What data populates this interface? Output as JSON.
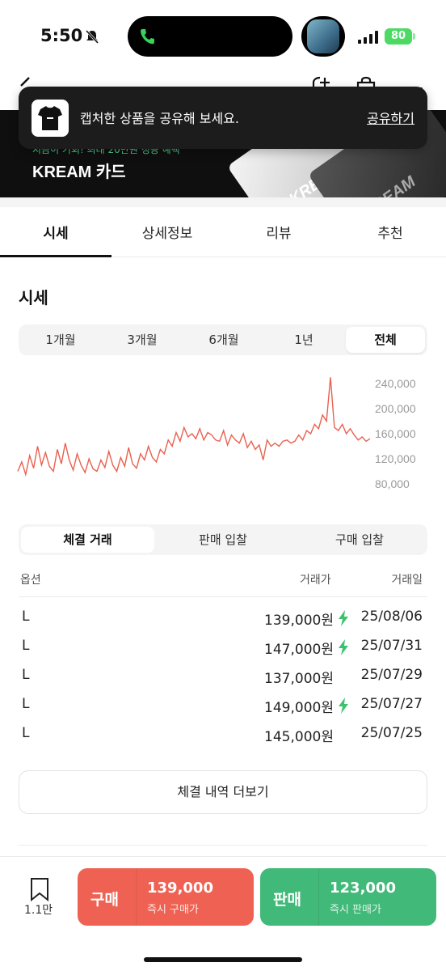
{
  "status": {
    "time": "5:50",
    "battery": "80"
  },
  "banner": {
    "small_text": "지금이 기회! 최대 20만원 정용 혜택",
    "title": "KREAM 카드",
    "card_text_1": "KREAM",
    "card_text_2": "KREAM"
  },
  "toast": {
    "message": "캡처한 상품을 공유해 보세요.",
    "action": "공유하기"
  },
  "tabs": [
    {
      "label": "시세"
    },
    {
      "label": "상세정보"
    },
    {
      "label": "리뷰"
    },
    {
      "label": "추천"
    }
  ],
  "price_section": {
    "title": "시세",
    "periods": [
      {
        "label": "1개월"
      },
      {
        "label": "3개월"
      },
      {
        "label": "6개월"
      },
      {
        "label": "1년"
      },
      {
        "label": "전체"
      }
    ],
    "active_period": "전체"
  },
  "chart_data": {
    "type": "line",
    "yticks": [
      "240,000",
      "200,000",
      "160,000",
      "120,000",
      "80,000"
    ],
    "ylim": [
      80000,
      240000
    ],
    "color": "#e9604f",
    "values": [
      100000,
      115000,
      95000,
      125000,
      105000,
      140000,
      110000,
      130000,
      108000,
      100000,
      135000,
      112000,
      145000,
      118000,
      102000,
      128000,
      110000,
      98000,
      120000,
      104000,
      100000,
      118000,
      106000,
      132000,
      110000,
      100000,
      122000,
      108000,
      138000,
      112000,
      105000,
      128000,
      118000,
      140000,
      122000,
      115000,
      135000,
      128000,
      150000,
      140000,
      162000,
      148000,
      170000,
      155000,
      160000,
      152000,
      168000,
      150000,
      162000,
      158000,
      150000,
      148000,
      165000,
      142000,
      158000,
      150000,
      145000,
      160000,
      138000,
      148000,
      135000,
      142000,
      118000,
      150000,
      140000,
      145000,
      140000,
      148000,
      150000,
      145000,
      148000,
      158000,
      150000,
      165000,
      160000,
      175000,
      168000,
      190000,
      180000,
      250000,
      170000,
      165000,
      175000,
      160000,
      168000,
      158000,
      150000,
      155000,
      148000,
      152000
    ]
  },
  "deal_tabs": [
    {
      "label": "체결 거래"
    },
    {
      "label": "판매 입찰"
    },
    {
      "label": "구매 입찰"
    }
  ],
  "table": {
    "headers": {
      "option": "옵션",
      "price": "거래가",
      "date": "거래일"
    },
    "rows": [
      {
        "option": "L",
        "price": "139,000원",
        "date": "25/08/06",
        "quick": true
      },
      {
        "option": "L",
        "price": "147,000원",
        "date": "25/07/31",
        "quick": true
      },
      {
        "option": "L",
        "price": "137,000원",
        "date": "25/07/29",
        "quick": false
      },
      {
        "option": "L",
        "price": "149,000원",
        "date": "25/07/27",
        "quick": true
      },
      {
        "option": "L",
        "price": "145,000원",
        "date": "25/07/25",
        "quick": false
      }
    ]
  },
  "more_button": "체결 내역 더보기",
  "bottom": {
    "bookmark_count": "1.1만",
    "buy": {
      "label": "구매",
      "price": "139,000",
      "sub": "즉시 구매가"
    },
    "sell": {
      "label": "판매",
      "price": "123,000",
      "sub": "즉시 판매가"
    }
  }
}
